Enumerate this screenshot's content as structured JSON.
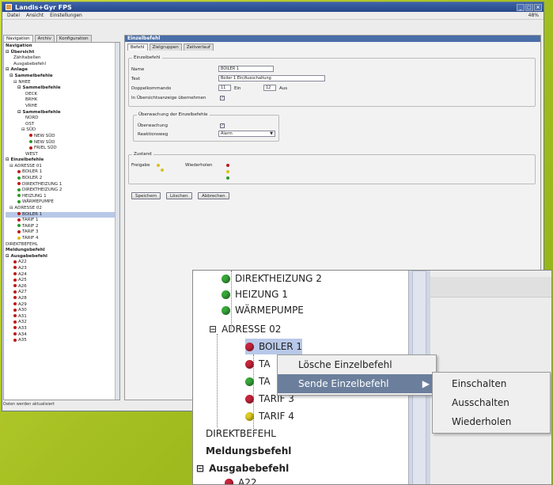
{
  "window": {
    "title": "Landis+Gyr FPS",
    "controls": [
      "_",
      "□",
      "×"
    ]
  },
  "menubar": {
    "items": [
      "Datei",
      "Ansicht",
      "Einstellungen"
    ],
    "zoom": "48%"
  },
  "left_tabs": [
    "Navigation",
    "Archiv",
    "Konfiguration"
  ],
  "tree_items": [
    {
      "label": "Navigation",
      "indent": 0,
      "bold": true
    },
    {
      "label": "⊟ Übersicht",
      "indent": 0,
      "bold": true
    },
    {
      "label": "Zähltabellen",
      "indent": 2
    },
    {
      "label": "Ausgabebefehl",
      "indent": 2
    },
    {
      "label": "⊟ Anlage",
      "indent": 0,
      "bold": true
    },
    {
      "label": "⊟ Sammelbefehle",
      "indent": 1,
      "bold": true
    },
    {
      "label": "⊟ NHEE",
      "indent": 2
    },
    {
      "label": "⊟ Sammelbefehle",
      "indent": 3,
      "bold": true
    },
    {
      "label": "DECK",
      "indent": 5
    },
    {
      "label": "BRHK",
      "indent": 5
    },
    {
      "label": "VRHE",
      "indent": 5
    },
    {
      "label": "⊟ Sammelbefehle",
      "indent": 3,
      "bold": true
    },
    {
      "label": "NORD",
      "indent": 5
    },
    {
      "label": "OST",
      "indent": 5
    },
    {
      "label": "⊟ SÜD",
      "indent": 4
    },
    {
      "label": "NEW SÜD",
      "indent": 6,
      "dot": "r"
    },
    {
      "label": "NEW SÜD",
      "indent": 6,
      "dot": "g"
    },
    {
      "label": "FRIEL SÜD",
      "indent": 6,
      "dot": "r"
    },
    {
      "label": "WEST",
      "indent": 5
    },
    {
      "label": "⊟ Einzelbefehle",
      "indent": 0,
      "bold": true
    },
    {
      "label": "⊟ ADRESSE 01",
      "indent": 1
    },
    {
      "label": "BOILER 1",
      "indent": 3,
      "dot": "r"
    },
    {
      "label": "BOILER 2",
      "indent": 3,
      "dot": "g"
    },
    {
      "label": "DIREKTHEIZUNG 1",
      "indent": 3,
      "dot": "r"
    },
    {
      "label": "DIREKTHEIZUNG 2",
      "indent": 3,
      "dot": "g"
    },
    {
      "label": "HEIZUNG 1",
      "indent": 3,
      "dot": "g"
    },
    {
      "label": "WÄRMEPUMPE",
      "indent": 3,
      "dot": "g"
    },
    {
      "label": "⊟ ADRESSE 02",
      "indent": 1
    },
    {
      "label": "BOILER 1",
      "indent": 3,
      "dot": "r",
      "selected": true
    },
    {
      "label": "TARIF 1",
      "indent": 3,
      "dot": "r"
    },
    {
      "label": "TARIF 2",
      "indent": 3,
      "dot": "g"
    },
    {
      "label": "TARIF 3",
      "indent": 3,
      "dot": "r"
    },
    {
      "label": "TARIF 4",
      "indent": 3,
      "dot": "y"
    },
    {
      "label": "DIREKTBEFEHL",
      "indent": 0
    },
    {
      "label": "Meldungsbefehl",
      "indent": 0,
      "bold": true
    },
    {
      "label": "⊟ Ausgabebefehl",
      "indent": 0,
      "bold": true
    },
    {
      "label": "A22",
      "indent": 2,
      "dot": "r"
    },
    {
      "label": "A23",
      "indent": 2,
      "dot": "r"
    },
    {
      "label": "A24",
      "indent": 2,
      "dot": "r"
    },
    {
      "label": "A25",
      "indent": 2,
      "dot": "r"
    },
    {
      "label": "A26",
      "indent": 2,
      "dot": "r"
    },
    {
      "label": "A27",
      "indent": 2,
      "dot": "r"
    },
    {
      "label": "A28",
      "indent": 2,
      "dot": "r"
    },
    {
      "label": "A29",
      "indent": 2,
      "dot": "r"
    },
    {
      "label": "A30",
      "indent": 2,
      "dot": "r"
    },
    {
      "label": "A31",
      "indent": 2,
      "dot": "r"
    },
    {
      "label": "A32",
      "indent": 2,
      "dot": "r"
    },
    {
      "label": "A33",
      "indent": 2,
      "dot": "r"
    },
    {
      "label": "A34",
      "indent": 2,
      "dot": "r"
    },
    {
      "label": "A35",
      "indent": 2,
      "dot": "r"
    }
  ],
  "status_text": "Daten werden aktualisiert",
  "panel": {
    "title": "Einzelbefehl",
    "tabs": [
      "Befehl",
      "Zielgruppen",
      "Zeitverlauf"
    ],
    "group1_legend": "Einzelbefehl",
    "name_label": "Name",
    "name_value": "BOILER 1",
    "text_label": "Text",
    "text_value": "Boiler 1 Ein/Ausschaltung",
    "doppel_label": "Doppelkommando",
    "doppel_v1": "11",
    "doppel_ein": "Ein",
    "doppel_v2": "12",
    "doppel_aus": "Aus",
    "ubers_label": "In Übersichtsanzeige übernehmen",
    "group2_legend": "Überwachung der Einzelbefehle",
    "uberw_label": "Überwachung",
    "reaktion_label": "Reaktionsweg",
    "reaktion_value": "Alarm",
    "group3_legend": "Zustand",
    "freigabe_label": "Freigabe",
    "wiederholen_label": "Wiederholen",
    "buttons": [
      "Speichern",
      "Löschen",
      "Abbrechen"
    ]
  },
  "zoom": {
    "items": [
      {
        "label": "DIREKTHEIZUNG 2",
        "dot": "g"
      },
      {
        "label": "HEIZUNG 1",
        "dot": "g"
      },
      {
        "label": "WÄRMEPUMPE",
        "dot": "g"
      },
      {
        "label": "ADRESSE 02",
        "expander": "⊟"
      },
      {
        "label": "BOILER 1",
        "dot": "r"
      },
      {
        "label": "TA",
        "dot": "r"
      },
      {
        "label": "TA",
        "dot": "g"
      },
      {
        "label": "TARIF 3",
        "dot": "r"
      },
      {
        "label": "TARIF 4",
        "dot": "y"
      },
      {
        "label": "DIREKTBEFEHL"
      },
      {
        "label": "Meldungsbefehl",
        "bold": true
      },
      {
        "label": "Ausgabebefehl",
        "bold": true,
        "expander": "⊟"
      },
      {
        "label": "A22",
        "dot": "r"
      }
    ],
    "context_menu": [
      "Lösche Einzelbefehl",
      "Sende Einzelbefehl"
    ],
    "submenu_arrow": "▶",
    "submenu": [
      "Einschalten",
      "Ausschalten",
      "Wiederholen"
    ]
  }
}
